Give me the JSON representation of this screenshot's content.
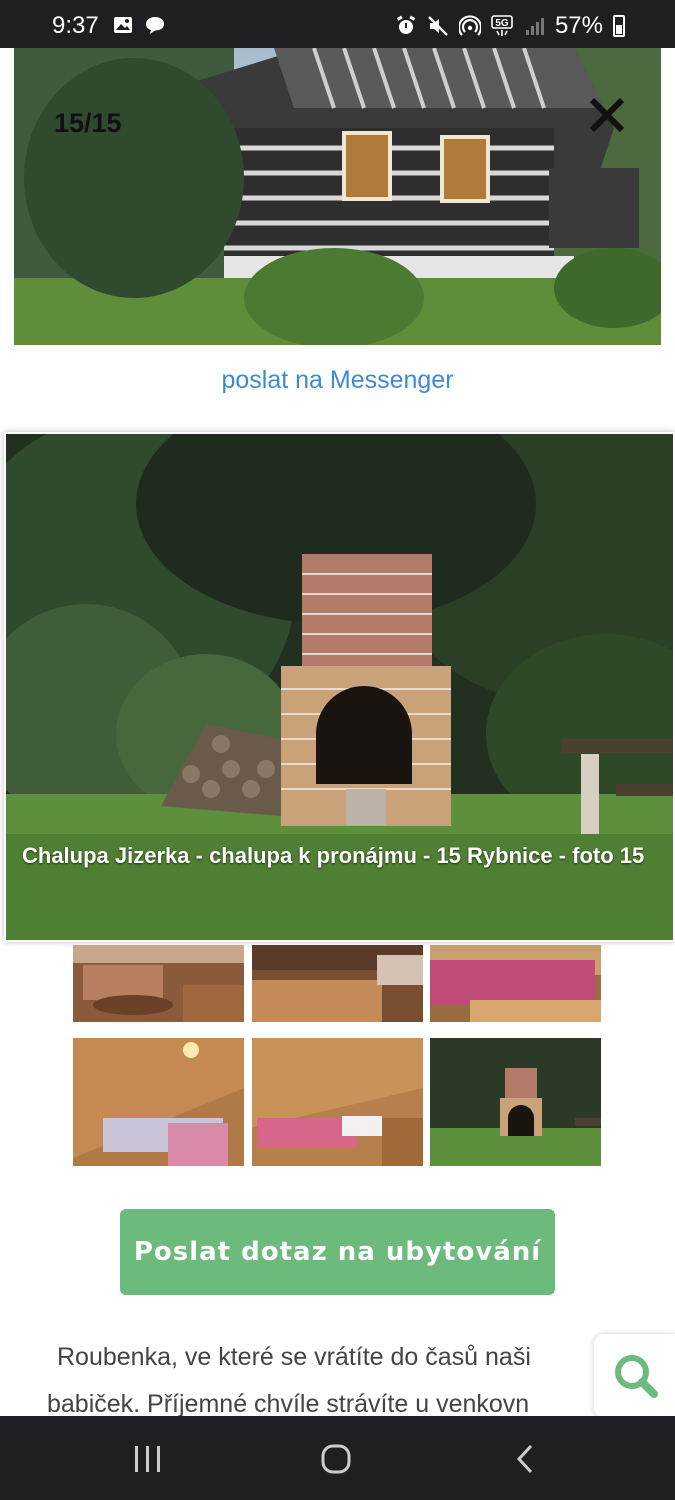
{
  "status_bar": {
    "time": "9:37",
    "network": "5G",
    "battery": "57%",
    "icons": [
      "gallery-icon",
      "chat-bubble-icon",
      "alarm-icon",
      "mute-icon",
      "hotspot-icon",
      "signal-icon",
      "battery-icon"
    ]
  },
  "gallery": {
    "counter": "15/15",
    "close_icon": "close-icon",
    "share_link": "poslat na Messenger",
    "caption": "Chalupa Jizerka - chalupa k pronájmu - 15 Rybnice - foto 15"
  },
  "thumbnails": [
    "living-room",
    "kitchen",
    "bedroom-pink",
    "attic-bedroom",
    "attic-bedroom-2",
    "outdoor-fireplace"
  ],
  "cta": {
    "label": "Poslat dotaz na ubytování"
  },
  "description": {
    "line1": "Roubenka, ve které se vrátíte do časů naši",
    "line2": "babiček. Příjemné chvíle strávíte u venkovn"
  },
  "search_fab": {
    "icon": "search-icon"
  },
  "nav_bar": {
    "icons": [
      "recent-apps-icon",
      "home-icon",
      "back-icon"
    ]
  },
  "colors": {
    "accent_green": "#6cbb7d",
    "link_blue": "#3b8bd6",
    "system_bar": "#1f1f23"
  }
}
